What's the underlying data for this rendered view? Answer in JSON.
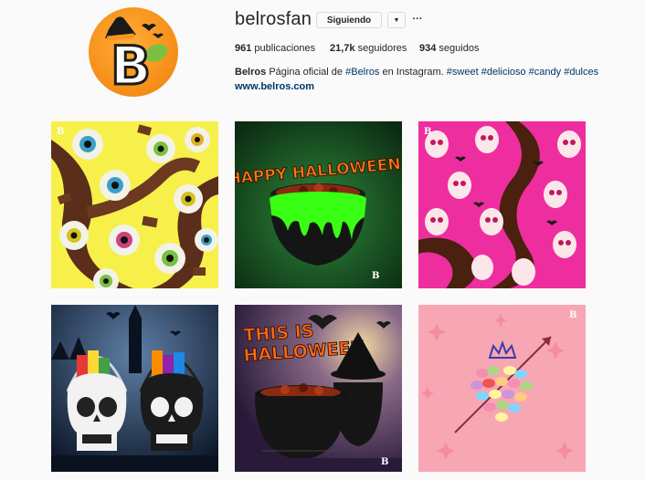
{
  "profile": {
    "username": "belrosfan",
    "follow_label": "Siguiendo",
    "dropdown_icon": "chevron-down-icon",
    "more_icon": "more-options-icon",
    "more_label": "···",
    "stats": {
      "posts_count": "961",
      "posts_label": "publicaciones",
      "followers_count": "21,7k",
      "followers_label": "seguidores",
      "following_count": "934",
      "following_label": "seguidos"
    },
    "bio": {
      "full_name": "Belros",
      "text_before": "Página oficial de",
      "mention": "#Belros",
      "text_after": "en Instagram.",
      "hashtags": "#sweet #delicioso #candy #dulces"
    },
    "website": "www.belros.com",
    "logo_letter": "B"
  },
  "posts": [
    {
      "name": "eyeball-candy-post",
      "mark": "B"
    },
    {
      "name": "happy-halloween-cauldron-post",
      "caption": "HAPPY HALLOWEEN!",
      "mark": "B"
    },
    {
      "name": "skull-candy-post",
      "mark": "B"
    },
    {
      "name": "skull-buckets-post"
    },
    {
      "name": "this-is-halloween-post",
      "caption_line1": "THIS IS",
      "caption_line2": "HALLOWEEN",
      "mark": "B"
    },
    {
      "name": "jelly-bean-heart-post",
      "mark": "B"
    }
  ],
  "colors": {
    "link": "#003569",
    "avatar_orange": "#f7941d",
    "slime_green": "#39ff14"
  }
}
